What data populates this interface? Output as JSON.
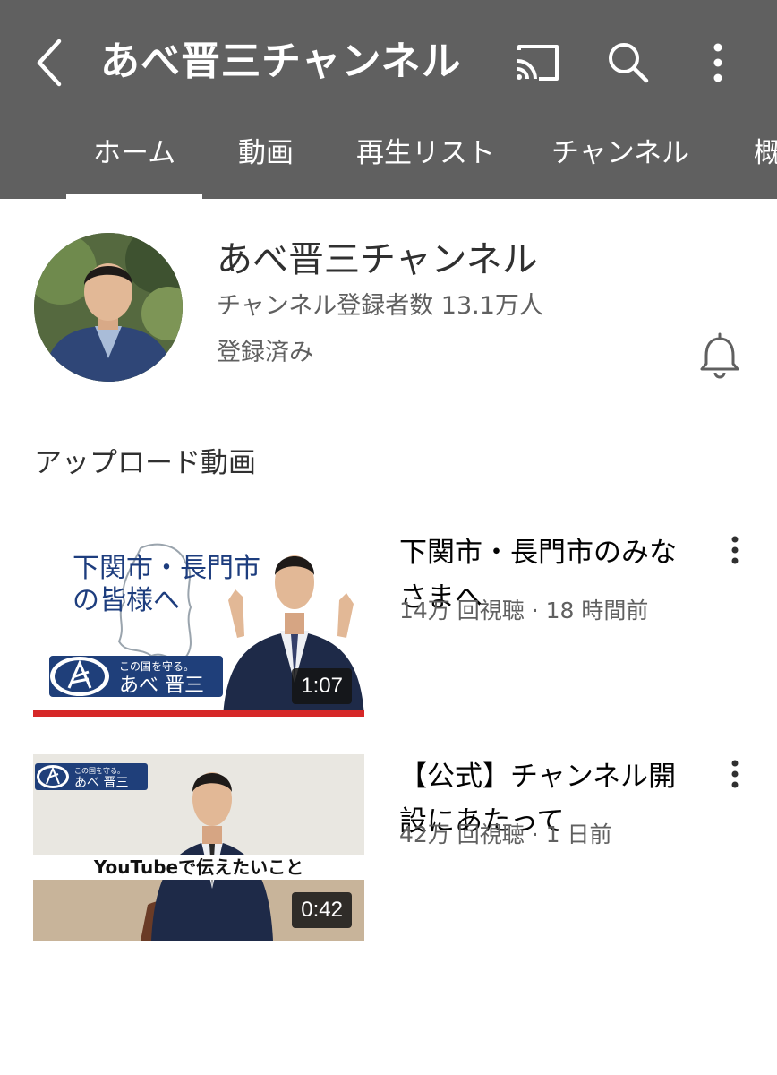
{
  "header": {
    "title": "あべ晋三チャンネル",
    "tabs": [
      {
        "label": "ホーム",
        "active": true
      },
      {
        "label": "動画",
        "active": false
      },
      {
        "label": "再生リスト",
        "active": false
      },
      {
        "label": "チャンネル",
        "active": false
      },
      {
        "label": "概",
        "active": false
      }
    ]
  },
  "channel": {
    "name": "あべ晋三チャンネル",
    "subscribers": "チャンネル登録者数 13.1万人",
    "status": "登録済み"
  },
  "section": {
    "title": "アップロード動画"
  },
  "videos": [
    {
      "title": "下関市・長門市のみなさまへ",
      "meta": "14万 回視聴 · 18 時間前",
      "duration": "1:07",
      "thumb_heading_line1": "下関市・長門市",
      "thumb_heading_line2": "の皆様へ",
      "thumb_logo_tagline": "この国を守る。",
      "thumb_logo_name": "あべ 晋三"
    },
    {
      "title": "【公式】チャンネル開設にあたって",
      "meta": "42万 回視聴 · 1 日前",
      "duration": "0:42",
      "thumb_logo_tagline": "この国を守る。",
      "thumb_logo_name": "あべ 晋三",
      "thumb_caption": "YouTubeで伝えたいこと"
    }
  ],
  "colors": {
    "appbar": "#606060",
    "text_primary": "#030303",
    "text_secondary": "#606060",
    "thumb_red_stripe": "#d62828",
    "logo_navy": "#1f3f7a"
  }
}
